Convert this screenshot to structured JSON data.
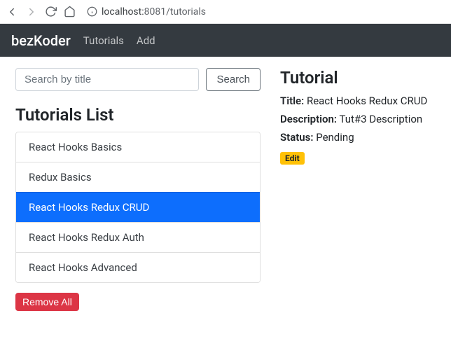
{
  "browser": {
    "url_host": "localhost:",
    "url_port_path": "8081/tutorials"
  },
  "navbar": {
    "brand": "bezKoder",
    "links": [
      "Tutorials",
      "Add"
    ]
  },
  "search": {
    "placeholder": "Search by title",
    "button": "Search"
  },
  "list": {
    "heading": "Tutorials List",
    "items": [
      "React Hooks Basics",
      "Redux Basics",
      "React Hooks Redux CRUD",
      "React Hooks Redux Auth",
      "React Hooks Advanced"
    ],
    "active_index": 2,
    "remove_all": "Remove All"
  },
  "detail": {
    "heading": "Tutorial",
    "title_label": "Title:",
    "title_value": "React Hooks Redux CRUD",
    "description_label": "Description:",
    "description_value": "Tut#3 Description",
    "status_label": "Status:",
    "status_value": "Pending",
    "edit": "Edit"
  }
}
